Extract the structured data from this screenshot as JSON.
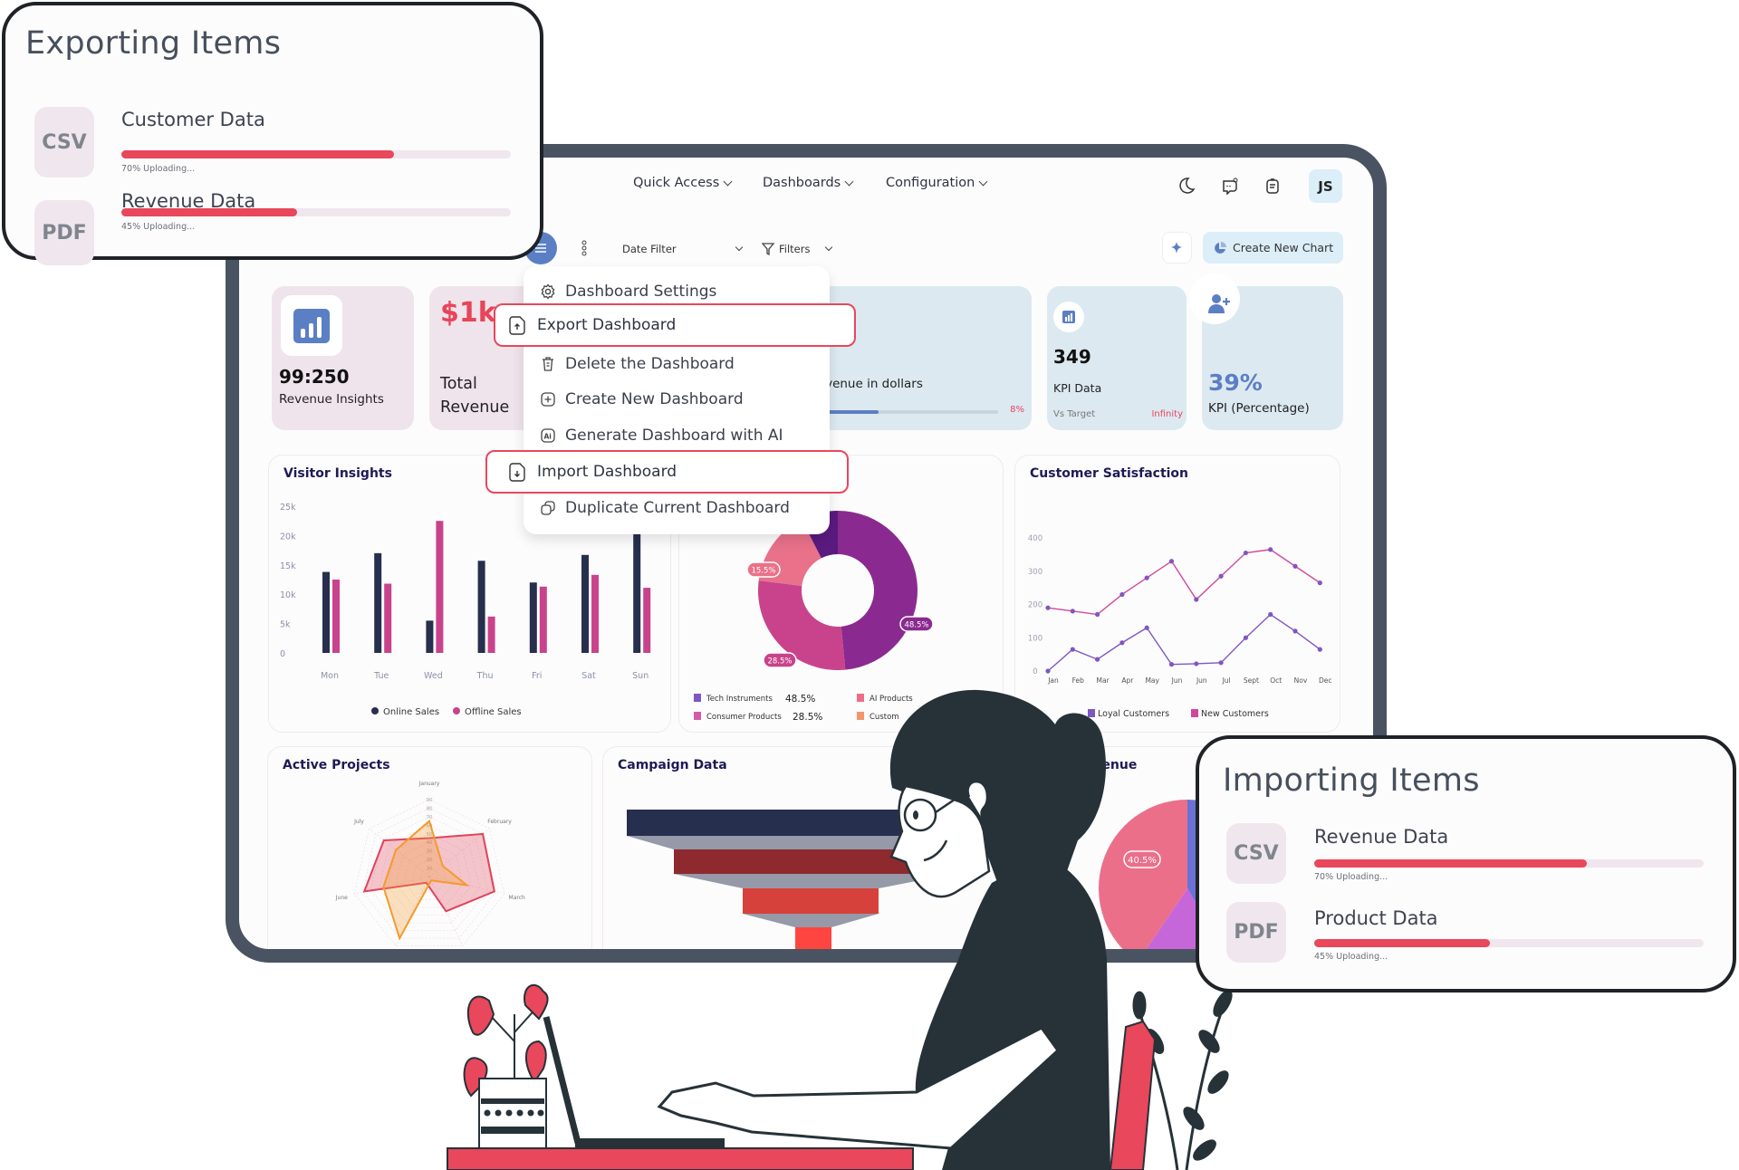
{
  "nav": {
    "quick_access": "Quick Access",
    "dashboards": "Dashboards",
    "configuration": "Configuration",
    "avatar": "JS"
  },
  "toolbar": {
    "date_filter": "Date Filter",
    "filters": "Filters",
    "create_chart": "Create New Chart"
  },
  "kpis": {
    "revenue_insights": {
      "value": "99:250",
      "label": "Revenue Insights"
    },
    "total_revenue": {
      "value": "$1k",
      "label_line1": "Total",
      "label_line2": "Revenue"
    },
    "revenue_dollars": {
      "label": "Revenue in dollars",
      "percent": "8%",
      "bar_fill_percent": 37
    },
    "kpi_data": {
      "value": "349",
      "label": "KPI Data",
      "target_label": "Vs Target",
      "target_value": "Infinity"
    },
    "kpi_percentage": {
      "value": "39%",
      "label": "KPI (Percentage)"
    }
  },
  "menu": {
    "items": [
      "Dashboard Settings",
      "Export Dashboard",
      "Delete the Dashboard",
      "Create New Dashboard",
      "Generate Dashboard with AI",
      "Import Dashboard",
      "Duplicate Current Dashboard"
    ]
  },
  "cards": {
    "visitor": "Visitor Insights",
    "satisfaction": "Customer Satisfaction",
    "active": "Active Projects",
    "campaign": "Campaign Data",
    "revenue": "Revenue"
  },
  "exporting": {
    "title": "Exporting Items",
    "items": [
      {
        "type": "CSV",
        "name": "Customer Data",
        "progress": 70,
        "status": "70% Uploading..."
      },
      {
        "type": "PDF",
        "name": "Revenue Data",
        "progress": 45,
        "status": "45% Uploading..."
      }
    ]
  },
  "importing": {
    "title": "Importing Items",
    "items": [
      {
        "type": "CSV",
        "name": "Revenue Data",
        "progress": 70,
        "status": "70% Uploading..."
      },
      {
        "type": "PDF",
        "name": "Product Data",
        "progress": 45,
        "status": "45% Uploading..."
      }
    ]
  },
  "colors": {
    "accent": "#e8475c",
    "blue": "#5b7fc4",
    "navy": "#262f4d",
    "magenta": "#c8438c"
  },
  "chart_data": [
    {
      "type": "bar",
      "title": "Visitor Insights",
      "categories": [
        "Mon",
        "Tue",
        "Wed",
        "Thu",
        "Fri",
        "Sat",
        "Sun"
      ],
      "y_ticks": [
        "0",
        "5k",
        "10k",
        "15k",
        "20k",
        "25k"
      ],
      "ylim": [
        0,
        25000
      ],
      "series": [
        {
          "name": "Online Sales",
          "color": "#262f4d",
          "values": [
            13800,
            17000,
            5500,
            15700,
            12000,
            16700,
            20500
          ]
        },
        {
          "name": "Offline Sales",
          "color": "#c8438c",
          "values": [
            12500,
            11800,
            22500,
            6200,
            11300,
            13300,
            11100
          ]
        }
      ],
      "legend": "bottom"
    },
    {
      "type": "pie",
      "donut": true,
      "slices": [
        {
          "name": "Tech Instruments",
          "value": 48.5,
          "label": "48.5%",
          "color": "#8a2a90",
          "legend_color": "#7e57c2"
        },
        {
          "name": "Consumer Products",
          "value": 28.5,
          "label": "28.5%",
          "color": "#c8438c",
          "legend_color": "#d659a8"
        },
        {
          "name": "AI Products",
          "value": 15.5,
          "label": "15.5%",
          "color": "#e9718a",
          "legend_color": "#ec6d85"
        },
        {
          "name": "Custom",
          "value": 7.5,
          "label": "",
          "color": "#5a1a7e",
          "legend_color": "#f4956b"
        }
      ],
      "legend": "bottom"
    },
    {
      "type": "line",
      "title": "Customer Satisfaction",
      "categories": [
        "Jan",
        "Feb",
        "Mar",
        "Apr",
        "May",
        "Jun",
        "Jun",
        "Jul",
        "Sept",
        "Oct",
        "Nov",
        "Dec"
      ],
      "y_ticks": [
        "0",
        "100",
        "200",
        "300",
        "400"
      ],
      "ylim": [
        0,
        400
      ],
      "series": [
        {
          "name": "Loyal Customers",
          "color": "#7e57c2",
          "values": [
            0,
            65,
            35,
            85,
            130,
            20,
            22,
            25,
            100,
            170,
            120,
            65
          ]
        },
        {
          "name": "New Customers",
          "color": "#d1489a",
          "values": [
            190,
            180,
            170,
            230,
            280,
            330,
            215,
            285,
            355,
            365,
            315,
            265
          ]
        }
      ],
      "legend": "bottom"
    },
    {
      "type": "radar",
      "title": "Active Projects",
      "axes": [
        "January",
        "February",
        "March",
        "",
        "",
        "June",
        "July"
      ],
      "r_ticks": [
        "10",
        "20",
        "30",
        "40",
        "50",
        "60",
        "70",
        "80",
        "90"
      ],
      "rlim": [
        0,
        90
      ],
      "series": [
        {
          "color": "#e0435a",
          "values": [
            45,
            80,
            78,
            45,
            8,
            78,
            68
          ]
        },
        {
          "color": "#f39a2e",
          "values": [
            65,
            20,
            45,
            5,
            80,
            55,
            50
          ]
        }
      ]
    },
    {
      "type": "pie",
      "title": "Revenue",
      "slices": [
        {
          "value": 40.5,
          "label": "40.5%",
          "color": "#ec6f8a"
        },
        {
          "value": 17.8,
          "label": "",
          "color": "#c667d9"
        },
        {
          "value": 41.7,
          "label": "",
          "color": "#6a72d6"
        }
      ]
    }
  ]
}
